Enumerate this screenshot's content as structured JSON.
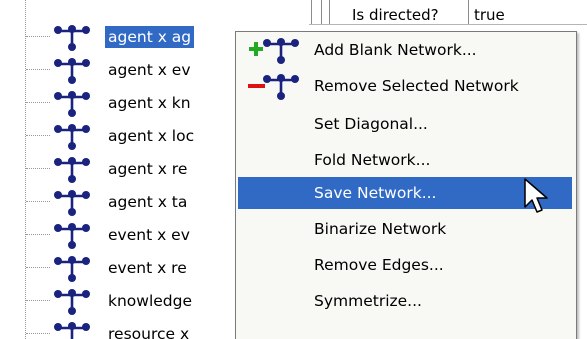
{
  "tree": {
    "items": [
      {
        "label": "agent x ag"
      },
      {
        "label": "agent x ev"
      },
      {
        "label": "agent x kn"
      },
      {
        "label": "agent x loc"
      },
      {
        "label": "agent x re"
      },
      {
        "label": "agent x ta"
      },
      {
        "label": "event x ev"
      },
      {
        "label": "event x re"
      },
      {
        "label": "knowledge"
      },
      {
        "label": "resource x"
      }
    ]
  },
  "properties": {
    "name": "Is directed?",
    "value": "true"
  },
  "context_menu": {
    "items": [
      {
        "label": "Add Blank Network...",
        "icon": "add-network-icon"
      },
      {
        "label": "Remove Selected Network",
        "icon": "remove-network-icon"
      },
      {
        "label": "Set Diagonal..."
      },
      {
        "label": "Fold Network..."
      },
      {
        "label": "Save Network..."
      },
      {
        "label": "Binarize Network"
      },
      {
        "label": "Remove Edges..."
      },
      {
        "label": "Symmetrize..."
      }
    ]
  },
  "colors": {
    "selection": "#316ac5",
    "menu_bg": "#f8f8f5",
    "network_icon": "#1a237e",
    "add_plus": "#22aa22",
    "remove_minus": "#dd1111"
  }
}
